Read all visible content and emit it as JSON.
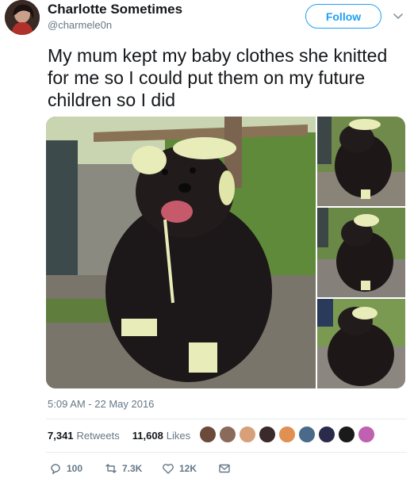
{
  "author": {
    "name": "Charlotte Sometimes",
    "handle": "@charmele0n"
  },
  "follow_label": "Follow",
  "tweet": {
    "text": "My mum kept my baby clothes she knitted for me so I could put them on my future children so I did",
    "timestamp": "5:09 AM - 22 May 2016"
  },
  "stats": {
    "retweets_count": "7,341",
    "retweets_label": "Retweets",
    "likes_count": "11,608",
    "likes_label": "Likes"
  },
  "actions": {
    "replies": "100",
    "retweets": "7.3K",
    "likes": "12K"
  },
  "colors": {
    "accent": "#1da1f2",
    "secondary_text": "#657786",
    "divider": "#e6ecf0"
  },
  "icons": [
    "chevron-down-icon",
    "reply-icon",
    "retweet-icon",
    "heart-icon",
    "envelope-icon"
  ]
}
